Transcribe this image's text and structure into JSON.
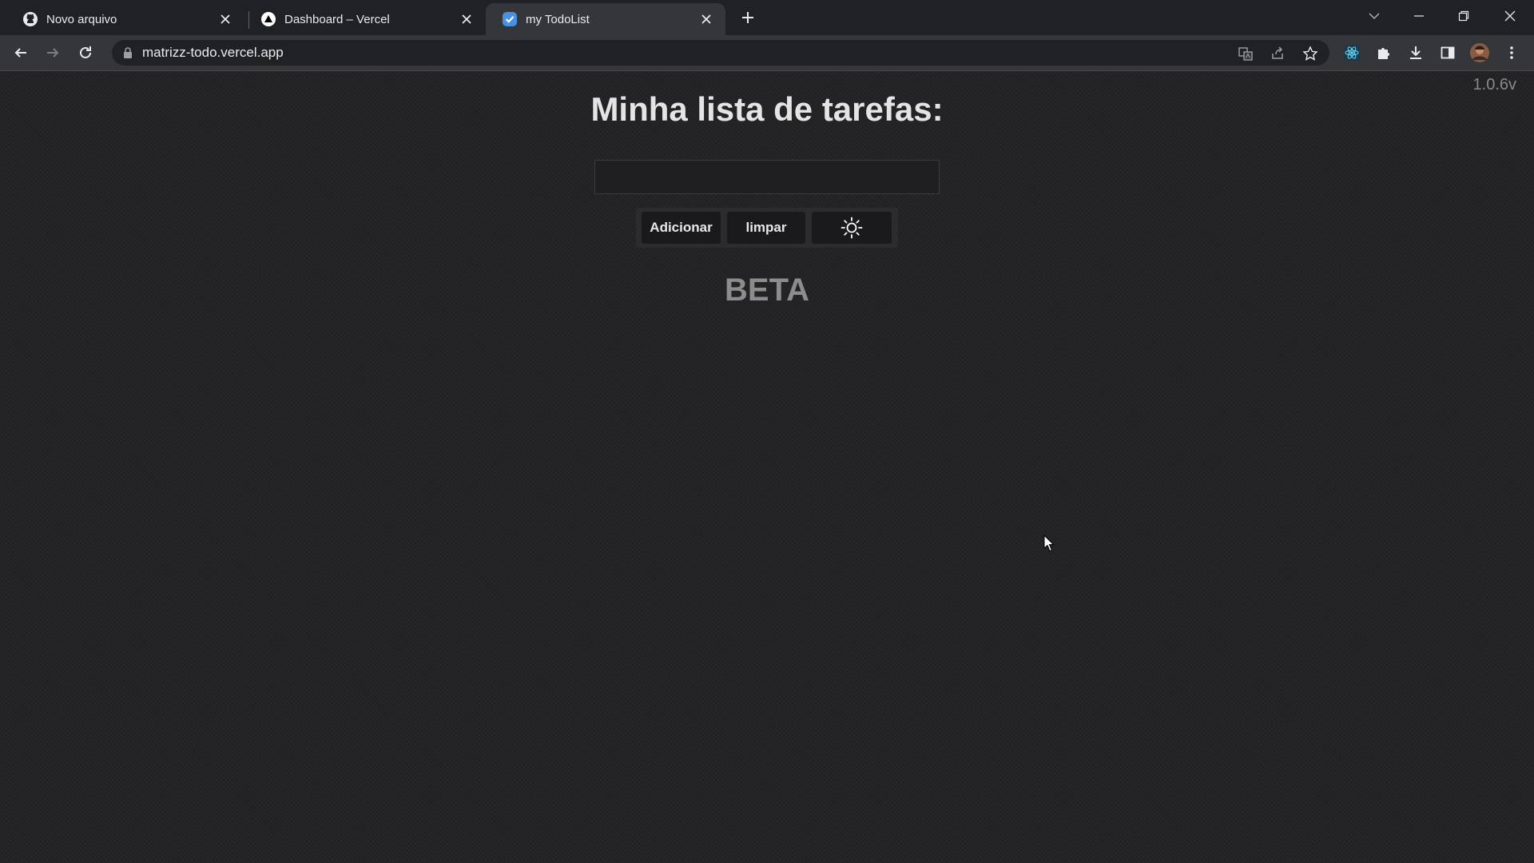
{
  "browser": {
    "tabs": [
      {
        "title": "Novo arquivo",
        "favicon": "github-icon",
        "active": false
      },
      {
        "title": "Dashboard – Vercel",
        "favicon": "vercel-icon",
        "active": false
      },
      {
        "title": "my TodoList",
        "favicon": "todo-check-icon",
        "active": true
      }
    ],
    "url": "matrizz-todo.vercel.app"
  },
  "page": {
    "version": "1.0.6v",
    "title": "Minha lista de tarefas:",
    "input": {
      "value": "",
      "placeholder": ""
    },
    "buttons": {
      "add_label": "Adicionar",
      "clear_label": "limpar",
      "theme_icon": "sun-icon"
    },
    "beta_label": "BETA"
  },
  "colors": {
    "background": "#232325",
    "title": "#e4e4e4",
    "button_bg": "#1a1a1c",
    "beta": "#8c8c8c",
    "accent_tab_icon": "#8ab4f8"
  }
}
